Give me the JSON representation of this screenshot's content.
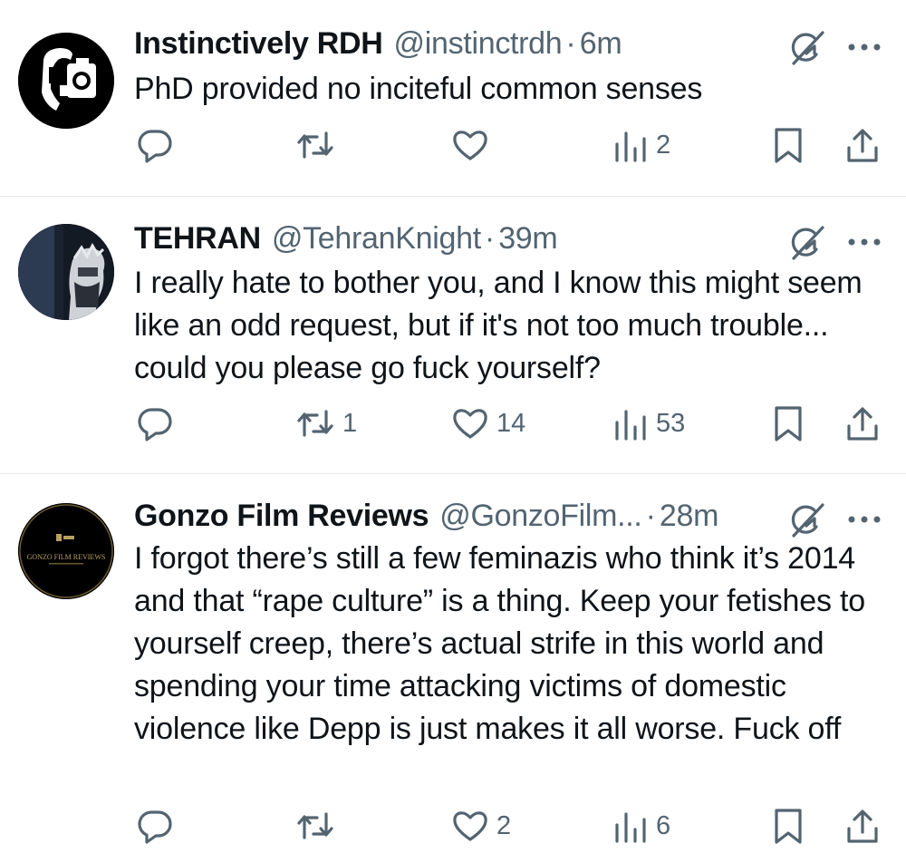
{
  "tweets": [
    {
      "name": "Instinctively RDH",
      "handle": "@instinctrdh",
      "separator": "·",
      "time": "6m",
      "text": "PhD provided no inciteful common senses",
      "replies": "",
      "retweets": "",
      "likes": "",
      "views": "2"
    },
    {
      "name": "TEHRAN",
      "handle": "@TehranKnight",
      "separator": "·",
      "time": "39m",
      "text": "I really hate to bother you, and I know this might seem like an odd request, but if it's not too much trouble... could you please go fuck yourself?",
      "replies": "",
      "retweets": "1",
      "likes": "14",
      "views": "53"
    },
    {
      "name": "Gonzo Film Reviews",
      "handle": "@GonzoFilm...",
      "separator": "·",
      "time": "28m",
      "text": "I forgot there’s still a few feminazis who think it’s 2014 and that “rape culture” is a thing. Keep your fetishes to yourself creep, there’s actual strife in this world and spending your time attacking victims of domestic violence like Depp is just makes it all worse. Fuck off",
      "avatar_text": "GONZO FILM REVIEWS",
      "replies": "",
      "retweets": "",
      "likes": "2",
      "views": "6"
    }
  ],
  "icons": {
    "reply": "reply-icon",
    "retweet": "retweet-icon",
    "like": "heart-icon",
    "views": "views-icon",
    "bookmark": "bookmark-icon",
    "share": "share-icon",
    "grok": "grok-icon",
    "more": "more-icon"
  },
  "colors": {
    "text": "#0f1419",
    "secondary": "#536471",
    "divider": "#e6e9ec",
    "background": "#ffffff"
  }
}
